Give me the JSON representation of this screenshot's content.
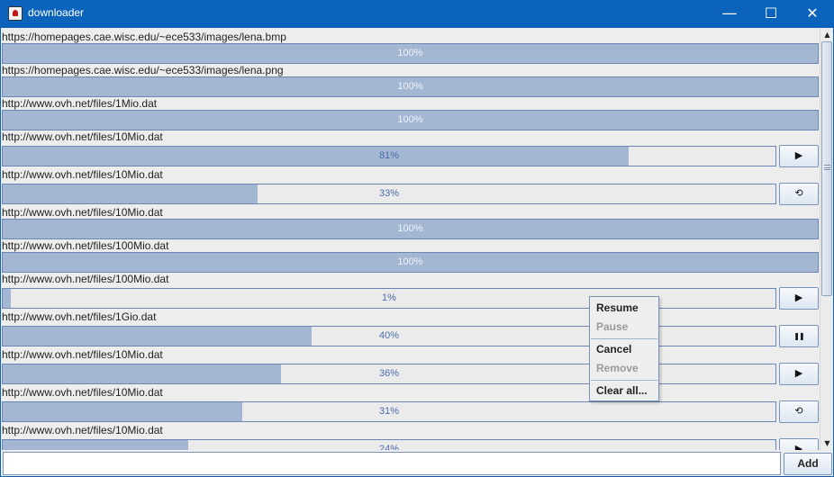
{
  "window": {
    "title": "downloader",
    "minimize_glyph": "—",
    "maximize_glyph": "☐",
    "close_glyph": "✕"
  },
  "colors": {
    "titlebar": "#0b63bb",
    "progress_fill": "#a3b7d2",
    "progress_track": "#ebebeb",
    "progress_border": "#6b86b4",
    "percent_text": "#4a6ca8"
  },
  "downloads": [
    {
      "url": "https://homepages.cae.wisc.edu/~ece533/images/lena.bmp",
      "progress": 100,
      "percent_label": "100%",
      "action": null
    },
    {
      "url": "https://homepages.cae.wisc.edu/~ece533/images/lena.png",
      "progress": 100,
      "percent_label": "100%",
      "action": null
    },
    {
      "url": "http://www.ovh.net/files/1Mio.dat",
      "progress": 100,
      "percent_label": "100%",
      "action": null
    },
    {
      "url": "http://www.ovh.net/files/10Mio.dat",
      "progress": 81,
      "percent_label": "81%",
      "action": "play-icon",
      "action_glyph": "▶"
    },
    {
      "url": "http://www.ovh.net/files/10Mio.dat",
      "progress": 33,
      "percent_label": "33%",
      "action": "retry-icon",
      "action_glyph": "⟲"
    },
    {
      "url": "http://www.ovh.net/files/10Mio.dat",
      "progress": 100,
      "percent_label": "100%",
      "action": null
    },
    {
      "url": "http://www.ovh.net/files/100Mio.dat",
      "progress": 100,
      "percent_label": "100%",
      "action": null
    },
    {
      "url": "http://www.ovh.net/files/100Mio.dat",
      "progress": 1,
      "percent_label": "1%",
      "action": "play-icon",
      "action_glyph": "▶"
    },
    {
      "url": "http://www.ovh.net/files/1Gio.dat",
      "progress": 40,
      "percent_label": "40%",
      "action": "pause-icon",
      "action_glyph": "❚❚"
    },
    {
      "url": "http://www.ovh.net/files/10Mio.dat",
      "progress": 36,
      "percent_label": "36%",
      "action": "play-icon",
      "action_glyph": "▶"
    },
    {
      "url": "http://www.ovh.net/files/10Mio.dat",
      "progress": 31,
      "percent_label": "31%",
      "action": "retry-icon",
      "action_glyph": "⟲"
    },
    {
      "url": "http://www.ovh.net/files/10Mio.dat",
      "progress": 24,
      "percent_label": "24%",
      "action": "play-icon",
      "action_glyph": "▶"
    }
  ],
  "context_menu": {
    "resume": "Resume",
    "pause": "Pause",
    "cancel": "Cancel",
    "remove": "Remove",
    "clear_all": "Clear all..."
  },
  "scrollbar": {
    "up_glyph": "▲",
    "down_glyph": "▼"
  },
  "footer": {
    "url_value": "",
    "add_label": "Add"
  }
}
